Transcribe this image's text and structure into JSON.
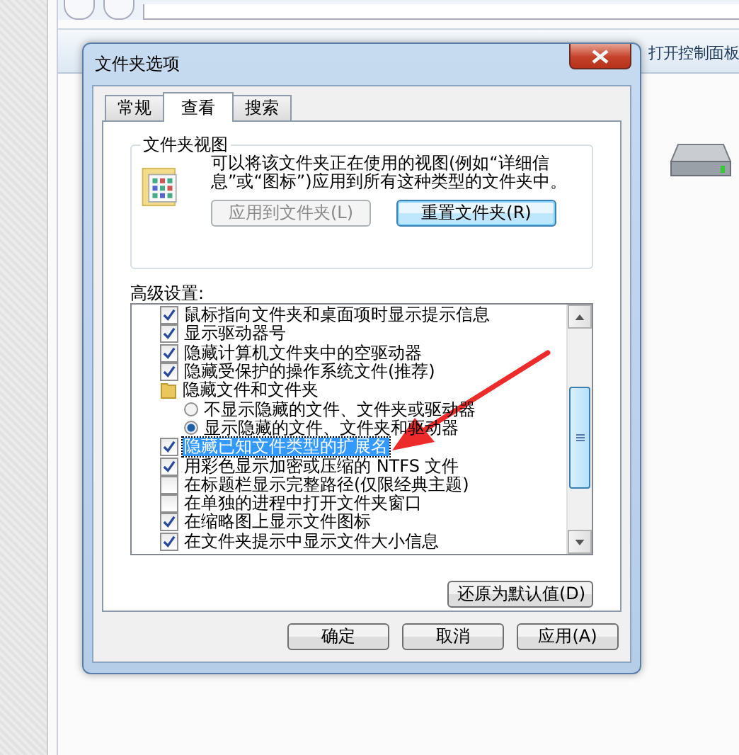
{
  "explorer": {
    "toolbar": [
      {
        "label": "打开控制面板"
      }
    ]
  },
  "dialog": {
    "title": "文件夹选项",
    "tabs": [
      {
        "label": "常规",
        "selected": false
      },
      {
        "label": "查看",
        "selected": true
      },
      {
        "label": "搜索",
        "selected": false
      }
    ],
    "folder_views": {
      "heading": "文件夹视图",
      "description": "可以将该文件夹正在使用的视图(例如“详细信息”或“图标”)应用到所有这种类型的文件夹中。",
      "buttons": [
        {
          "label": "应用到文件夹(L)",
          "disabled": true
        },
        {
          "label": "重置文件夹(R)",
          "disabled": false
        }
      ]
    },
    "advanced": {
      "heading": "高级设置:",
      "items": [
        {
          "kind": "checkbox",
          "label": "鼠标指向文件夹和桌面项时显示提示信息",
          "checked": true,
          "selected": false
        },
        {
          "kind": "checkbox",
          "label": "显示驱动器号",
          "checked": true,
          "selected": false
        },
        {
          "kind": "checkbox",
          "label": "隐藏计算机文件夹中的空驱动器",
          "checked": true,
          "selected": false
        },
        {
          "kind": "checkbox",
          "label": "隐藏受保护的操作系统文件(推荐)",
          "checked": true,
          "selected": false
        },
        {
          "kind": "folder",
          "label": "隐藏文件和文件夹"
        },
        {
          "kind": "radio",
          "label": "不显示隐藏的文件、文件夹或驱动器",
          "checked": false,
          "selected": false
        },
        {
          "kind": "radio",
          "label": "显示隐藏的文件、文件夹和驱动器",
          "checked": true,
          "selected": false
        },
        {
          "kind": "checkbox",
          "label": "隐藏已知文件类型的扩展名",
          "checked": true,
          "selected": true
        },
        {
          "kind": "checkbox",
          "label": "用彩色显示加密或压缩的 NTFS 文件",
          "checked": true,
          "selected": false
        },
        {
          "kind": "checkbox",
          "label": "在标题栏显示完整路径(仅限经典主题)",
          "checked": false,
          "selected": false
        },
        {
          "kind": "checkbox",
          "label": "在单独的进程中打开文件夹窗口",
          "checked": false,
          "selected": false
        },
        {
          "kind": "checkbox",
          "label": "在缩略图上显示文件图标",
          "checked": true,
          "selected": false
        },
        {
          "kind": "checkbox",
          "label": "在文件夹提示中显示文件大小信息",
          "checked": true,
          "selected": false
        }
      ]
    },
    "restore_button": "还原为默认值(D)",
    "buttons": [
      "确定",
      "取消",
      "应用(A)"
    ]
  }
}
